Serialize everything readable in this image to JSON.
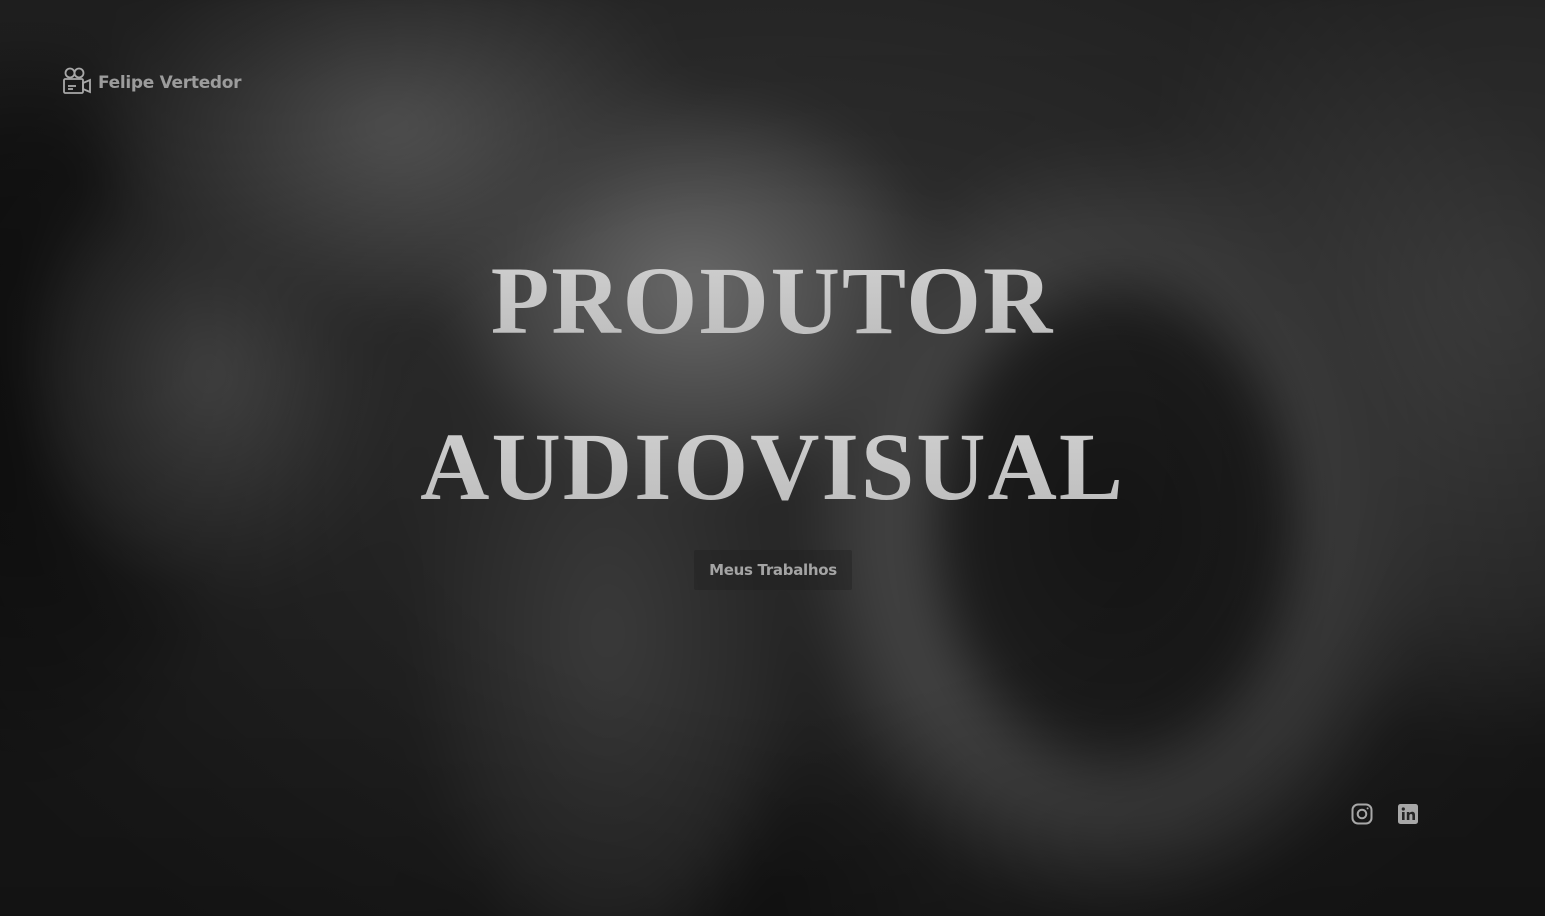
{
  "header": {
    "brand_name": "Felipe Vertedor",
    "brand_icon": "video-camera-icon"
  },
  "hero": {
    "line1": "PRODUTOR",
    "line2": "AUDIOVISUAL",
    "cta_label": "Meus Trabalhos"
  },
  "social": {
    "items": [
      {
        "icon": "instagram-icon"
      },
      {
        "icon": "linkedin-icon"
      }
    ]
  },
  "colors": {
    "text_primary": "#c2c2c2",
    "text_muted": "#9c9c9c",
    "icon": "#a8a8a8"
  }
}
